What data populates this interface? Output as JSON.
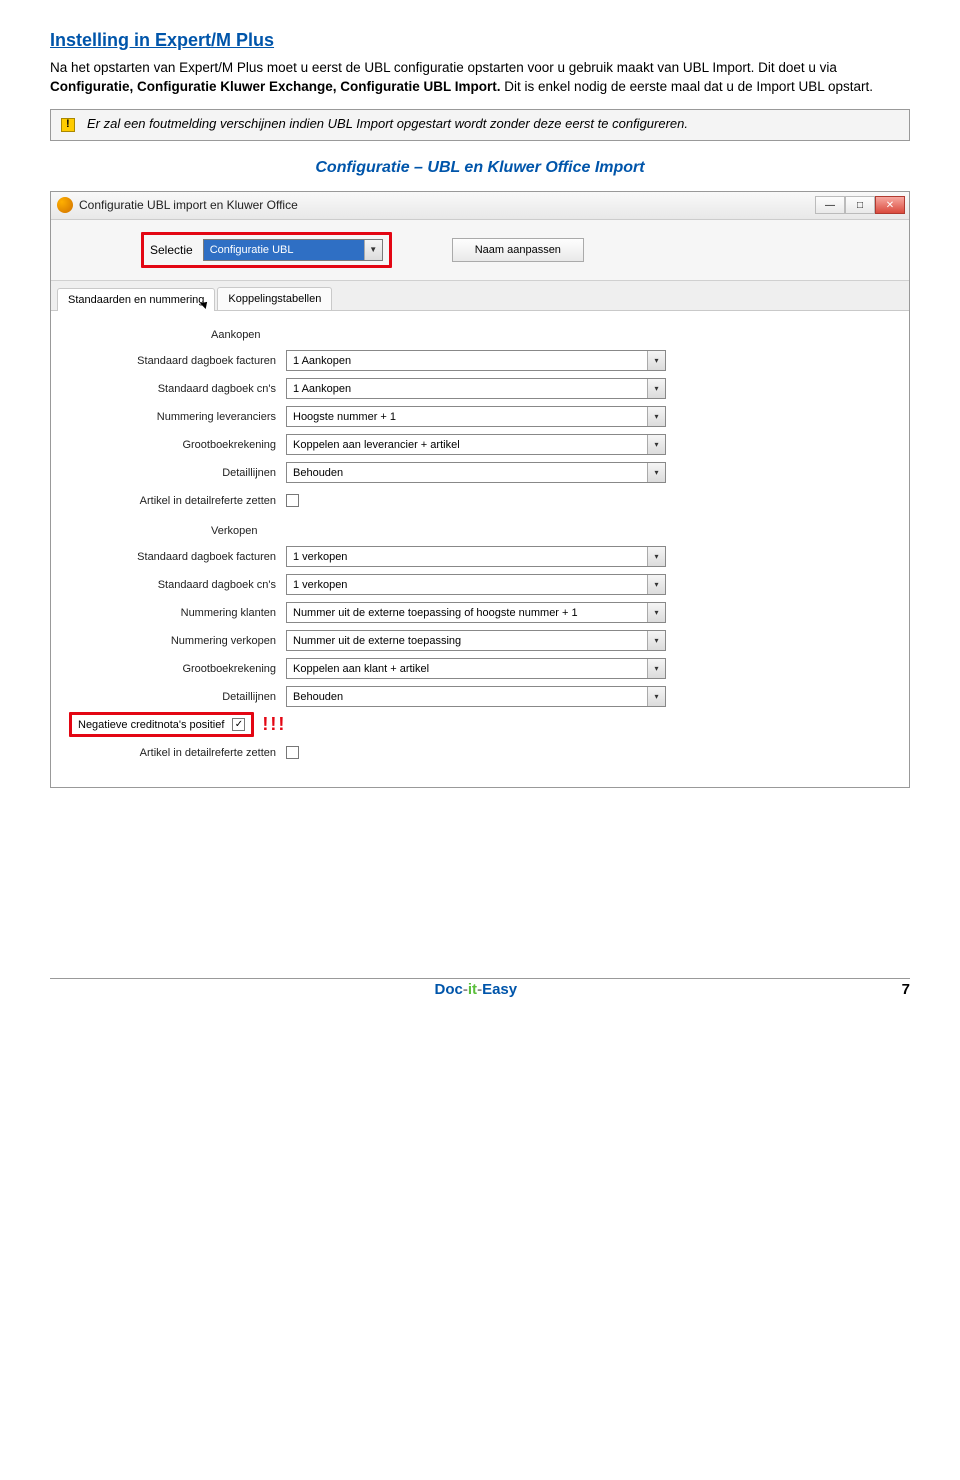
{
  "heading": "Instelling in Expert/M Plus",
  "paragraph": {
    "p1": "Na het opstarten van Expert/M Plus moet u eerst de UBL configuratie opstarten voor u gebruik maakt van UBL Import. Dit doet u via ",
    "p2": "Configuratie, Configuratie Kluwer Exchange, Configuratie UBL Import.",
    "p3": " Dit is enkel nodig de eerste maal dat u de Import UBL opstart."
  },
  "warning": "Er zal een foutmelding verschijnen indien UBL Import opgestart wordt zonder deze eerst te configureren.",
  "subtitle": "Configuratie – UBL en Kluwer Office Import",
  "window": {
    "title": "Configuratie UBL import en Kluwer Office",
    "btn_min": "—",
    "btn_max": "□",
    "btn_close": "✕",
    "top_label": "Selectie",
    "select_value": "Configuratie UBL",
    "btn_name": "Naam aanpassen",
    "tabs": {
      "t1": "Standaarden en nummering",
      "t2": "Koppelingstabellen"
    },
    "sections": {
      "aankopen": "Aankopen",
      "verkopen": "Verkopen"
    },
    "fields": {
      "std_fact": "Standaard dagboek facturen",
      "std_cn": "Standaard dagboek cn's",
      "num_lev": "Nummering leveranciers",
      "grootboek": "Grootboekrekening",
      "detail": "Detaillijnen",
      "art_ref": "Artikel in detailreferte zetten",
      "num_kl": "Nummering klanten",
      "num_vk": "Nummering verkopen",
      "neg_cn": "Negatieve creditnota's positief"
    },
    "values": {
      "aank_fact": "1 Aankopen",
      "aank_cn": "1 Aankopen",
      "aank_numlev": "Hoogste nummer + 1",
      "aank_gb": "Koppelen aan leverancier + artikel",
      "aank_det": "Behouden",
      "vk_fact": "1 verkopen",
      "vk_cn": "1 verkopen",
      "vk_numkl": "Nummer uit de externe toepassing of hoogste nummer + 1",
      "vk_numvk": "Nummer uit de externe toepassing",
      "vk_gb": "Koppelen aan klant + artikel",
      "vk_det": "Behouden"
    },
    "excl": "!!!"
  },
  "footer": {
    "brand_doc": "Doc",
    "brand_sep1": "-",
    "brand_it": "it",
    "brand_sep2": "-",
    "brand_easy": "Easy",
    "page": "7"
  }
}
